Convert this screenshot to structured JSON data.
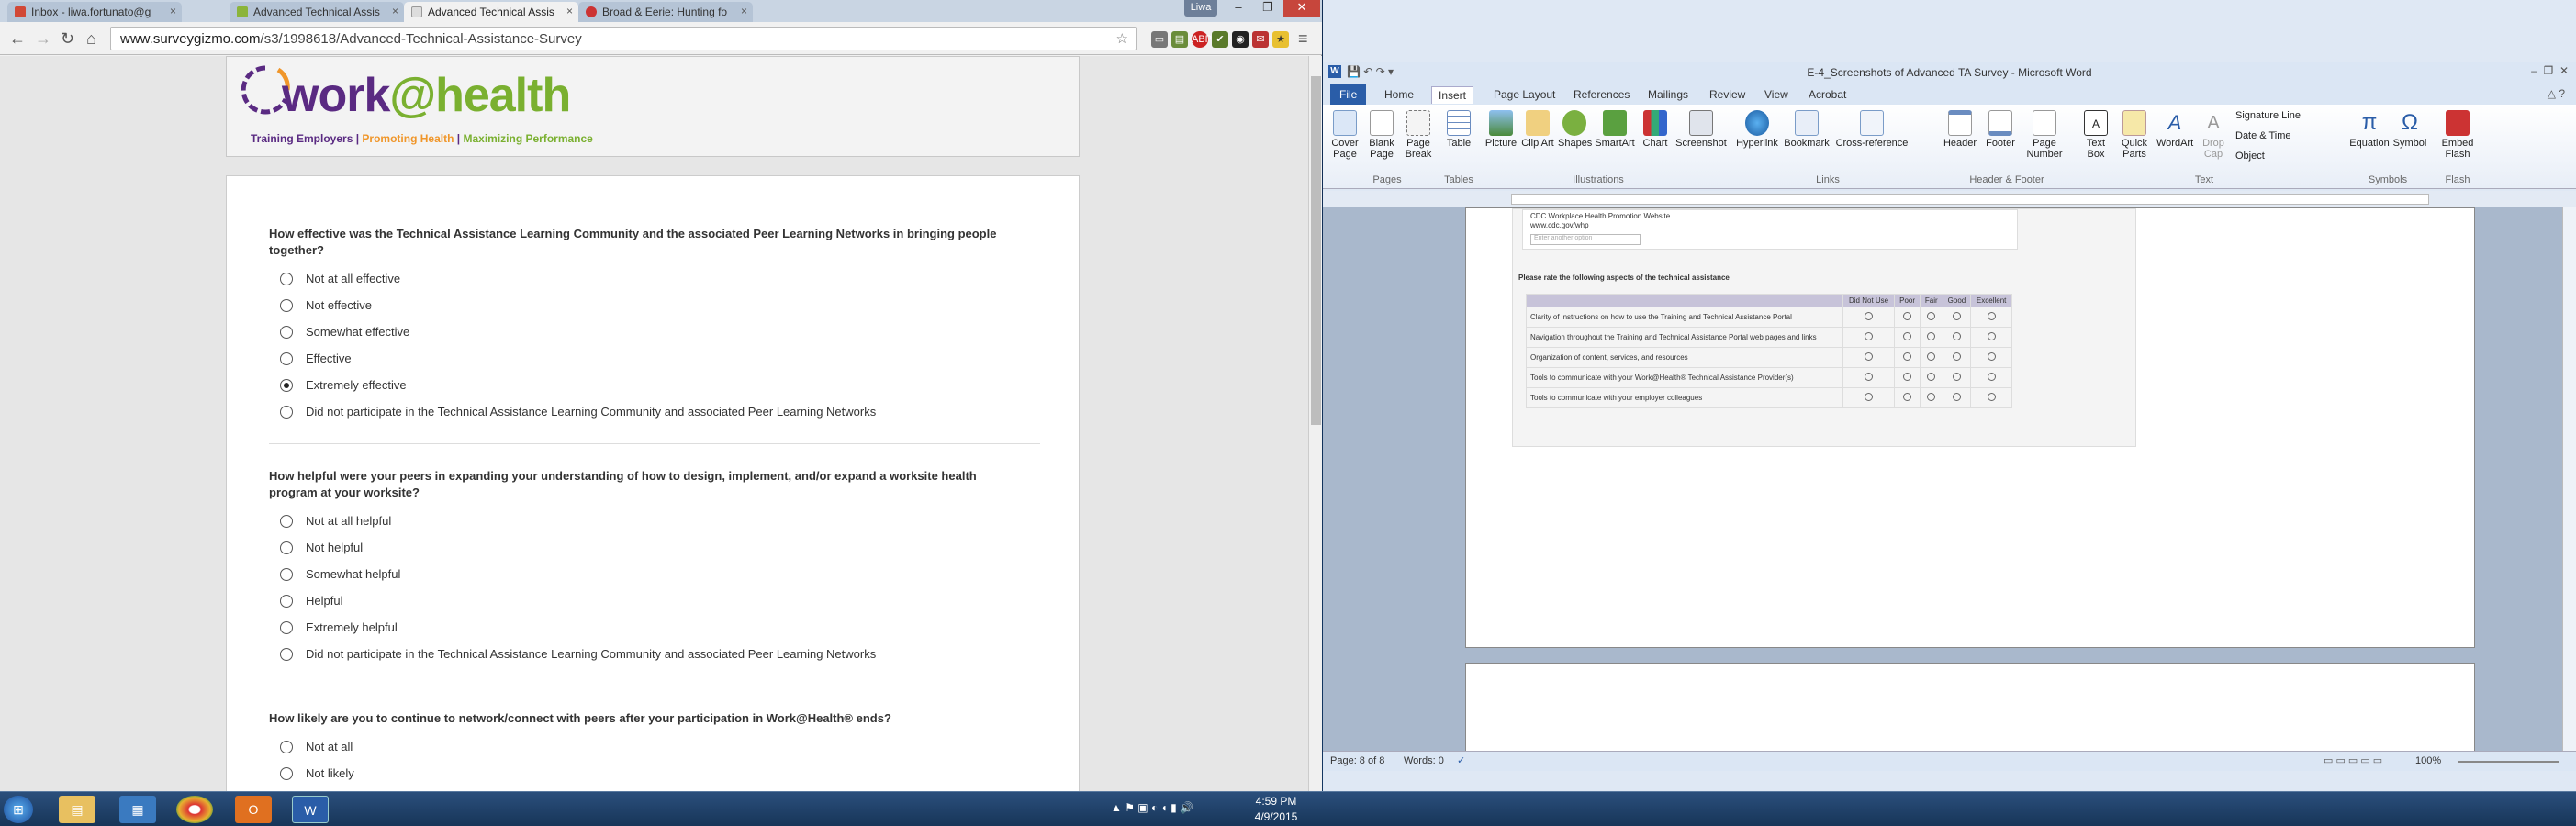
{
  "browser": {
    "tabs": [
      {
        "label": "Inbox - liwa.fortunato@g",
        "color": "#d14836"
      },
      {
        "label": "Advanced Technical Assis",
        "color": "#8bb43a"
      },
      {
        "label": "Advanced Technical Assis",
        "color": "#888888"
      },
      {
        "label": "Broad & Eerie: Hunting fo",
        "color": "#cc3333"
      }
    ],
    "url_domain": "www.surveygizmo.com",
    "url_path": "/s3/1998618/Advanced-Technical-Assistance-Survey",
    "user_badge": "Liwa"
  },
  "logo": {
    "text_a": "work",
    "text_b": "@health",
    "tag1": "Training Employers",
    "tag2": "Promoting Health",
    "tag3": "Maximizing Performance"
  },
  "survey": {
    "q1": {
      "text": "How effective was the Technical Assistance Learning Community and the associated Peer Learning Networks in bringing people together?",
      "options": [
        "Not at all effective",
        "Not effective",
        "Somewhat effective",
        "Effective",
        "Extremely effective",
        "Did not participate in the Technical Assistance Learning Community and associated Peer Learning Networks"
      ],
      "selected": "Extremely effective"
    },
    "q2": {
      "text": "How helpful were your peers in expanding your understanding of how to design, implement, and/or expand a worksite health program at your worksite?",
      "options": [
        "Not at all helpful",
        "Not helpful",
        "Somewhat helpful",
        "Helpful",
        "Extremely helpful",
        "Did not participate in the Technical Assistance Learning Community and associated Peer Learning Networks"
      ]
    },
    "q3": {
      "text": "How likely are you to continue to network/connect with peers after your participation in Work@Health® ends?",
      "options": [
        "Not at all",
        "Not likely"
      ]
    }
  },
  "word": {
    "title": "E-4_Screenshots of Advanced TA Survey - Microsoft Word",
    "tabs": [
      "File",
      "Home",
      "Insert",
      "Page Layout",
      "References",
      "Mailings",
      "Review",
      "View",
      "Acrobat"
    ],
    "ribbon": {
      "pages": [
        "Cover Page",
        "Blank Page",
        "Page Break"
      ],
      "tables": [
        "Table"
      ],
      "illustrations": [
        "Picture",
        "Clip Art",
        "Shapes",
        "SmartArt",
        "Chart",
        "Screenshot"
      ],
      "links": [
        "Hyperlink",
        "Bookmark",
        "Cross-reference"
      ],
      "header_footer": [
        "Header",
        "Footer",
        "Page Number"
      ],
      "text": [
        "Text Box",
        "Quick Parts",
        "WordArt",
        "Drop Cap"
      ],
      "text_side": [
        "Signature Line",
        "Date & Time",
        "Object"
      ],
      "symbols": [
        "Equation",
        "Symbol"
      ],
      "flash": [
        "Embed Flash"
      ],
      "groups": [
        "Pages",
        "Tables",
        "Illustrations",
        "Links",
        "Header & Footer",
        "Text",
        "Symbols",
        "Flash"
      ]
    },
    "doc": {
      "cdc_line1": "CDC Workplace Health Promotion Website",
      "cdc_line2": "www.cdc.gov/whp",
      "other_option": "Enter another option",
      "rate_title": "Please rate the following aspects of the technical assistance",
      "cols": [
        "Did Not Use",
        "Poor",
        "Fair",
        "Good",
        "Excellent"
      ],
      "rows": [
        "Clarity of instructions on how to use the Training and Technical Assistance Portal",
        "Navigation throughout the Training and Technical Assistance Portal web pages and links",
        "Organization of content, services, and resources",
        "Tools to communicate with your Work@Health® Technical Assistance Provider(s)",
        "Tools to communicate with your employer colleagues"
      ]
    },
    "status": {
      "page": "Page: 8 of 8",
      "words": "Words: 0",
      "zoom": "100%"
    }
  },
  "taskbar": {
    "time": "4:59 PM",
    "date": "4/9/2015"
  }
}
